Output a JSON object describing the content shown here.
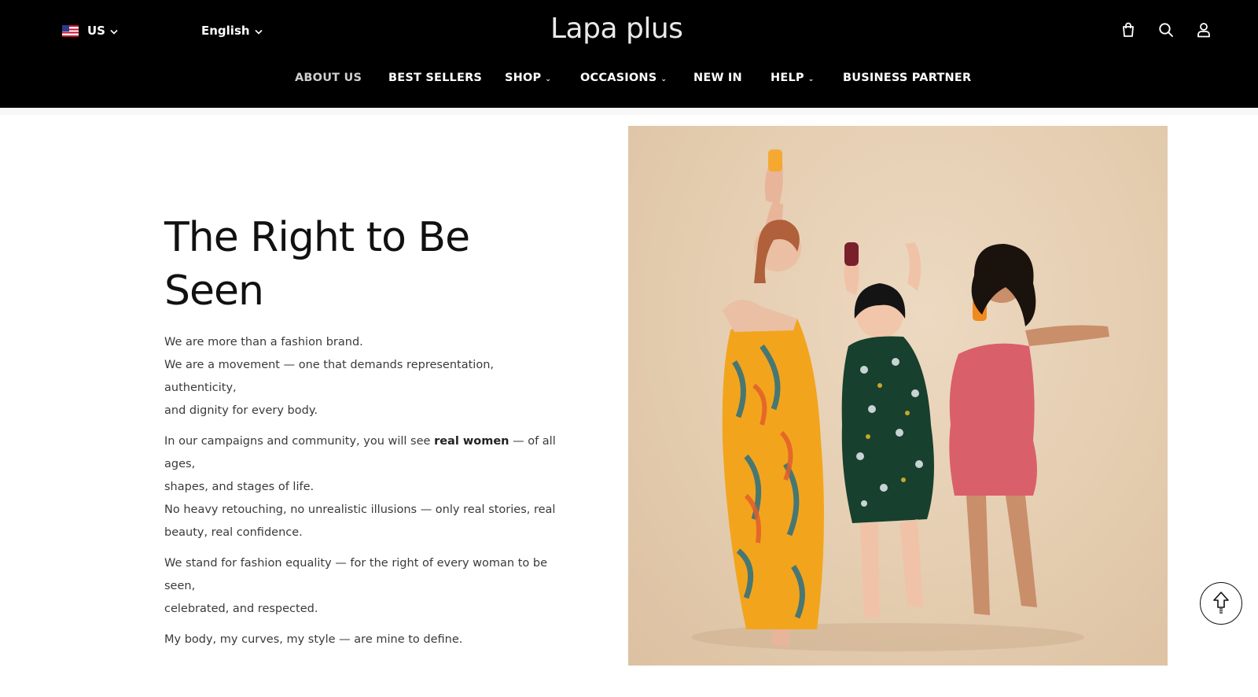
{
  "header": {
    "country": {
      "label": "US",
      "flag_icon": "us-flag-icon"
    },
    "language": {
      "label": "English"
    },
    "logo": "Lapa plus",
    "icons": [
      "cart-icon",
      "search-icon",
      "account-icon"
    ]
  },
  "nav": {
    "items": [
      {
        "label": "ABOUT US",
        "active": true,
        "has_dropdown": false
      },
      {
        "label": "BEST SELLERS",
        "active": false,
        "has_dropdown": false
      },
      {
        "label": "SHOP",
        "active": false,
        "has_dropdown": true
      },
      {
        "label": "OCCASIONS",
        "active": false,
        "has_dropdown": true
      },
      {
        "label": "NEW IN",
        "active": false,
        "has_dropdown": false
      },
      {
        "label": "HELP",
        "active": false,
        "has_dropdown": true
      },
      {
        "label": "BUSINESS PARTNER",
        "active": false,
        "has_dropdown": false
      }
    ]
  },
  "content": {
    "headline_line1": "The Right to Be",
    "headline_line2": "Seen",
    "p1_line1": "We are more than a fashion brand.",
    "p1_line2": "We are a movement — one that demands representation, authenticity,",
    "p1_line3": "and dignity for every body.",
    "p2_pre": "In our campaigns and community, you will see ",
    "p2_bold": "real women",
    "p2_post": " — of all ages,",
    "p2_line2": "shapes, and stages of life.",
    "p2_line3": "No heavy retouching, no unrealistic illusions — only real stories, real",
    "p2_line4": "beauty, real confidence.",
    "p3_line1": "We stand for fashion equality — for the right of every woman to be seen,",
    "p3_line2": "celebrated, and respected.",
    "p4_line1": "My body, my curves, my style — are mine to define."
  },
  "colors": {
    "header_bg": "#000000",
    "nav_text": "#ffffff",
    "nav_active_text": "#cfcfcf",
    "body_text": "#3a3a3a",
    "hero_bg": "#e6cfb3"
  }
}
